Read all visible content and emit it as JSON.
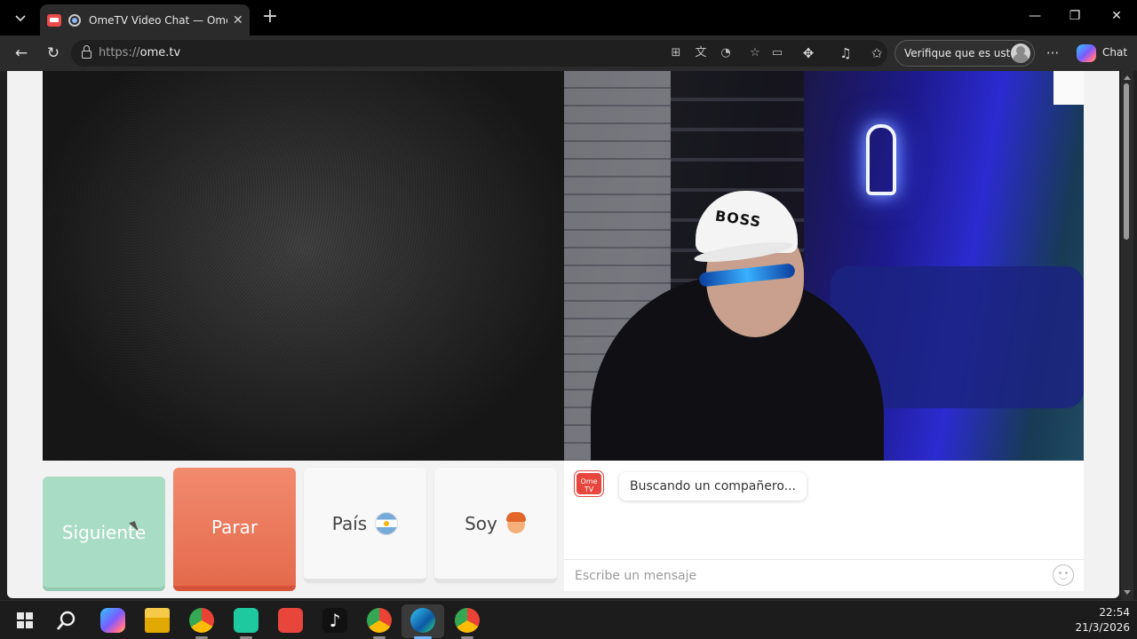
{
  "browser": {
    "tab_title": "OmeTV Video Chat — Omegle",
    "new_tab_symbol": "+",
    "url_scheme": "https://",
    "url_host": "ome.tv",
    "profile_label": "Verifique que es usted",
    "chat_label": "Chat",
    "more_symbol": "···",
    "window_minimize": "—",
    "window_restore": "❐",
    "window_close": "✕"
  },
  "controls": {
    "next_label": "Siguiente",
    "stop_label": "Parar",
    "country_label": "País",
    "country_flag": "argentina-flag",
    "soy_label": "Soy",
    "soy_avatar": "boy-avatar"
  },
  "chat": {
    "status_message": "Buscando un compañero...",
    "logo_text_top": "Ome",
    "logo_text_bottom": "TV",
    "input_placeholder": "Escribe un mensaje"
  },
  "video": {
    "cap_text": "BOSS"
  },
  "taskbar": {
    "time": "22:54",
    "date": "21/3/2026",
    "apps": [
      "windows-start",
      "search",
      "copilot",
      "file-explorer",
      "chrome",
      "capcut",
      "ometv",
      "tiktok",
      "chrome-profile",
      "edge",
      "chrome"
    ]
  },
  "colors": {
    "next_button": "#a8dcc4",
    "stop_button": "#e56a4c",
    "ome_brand": "#e8453c"
  }
}
